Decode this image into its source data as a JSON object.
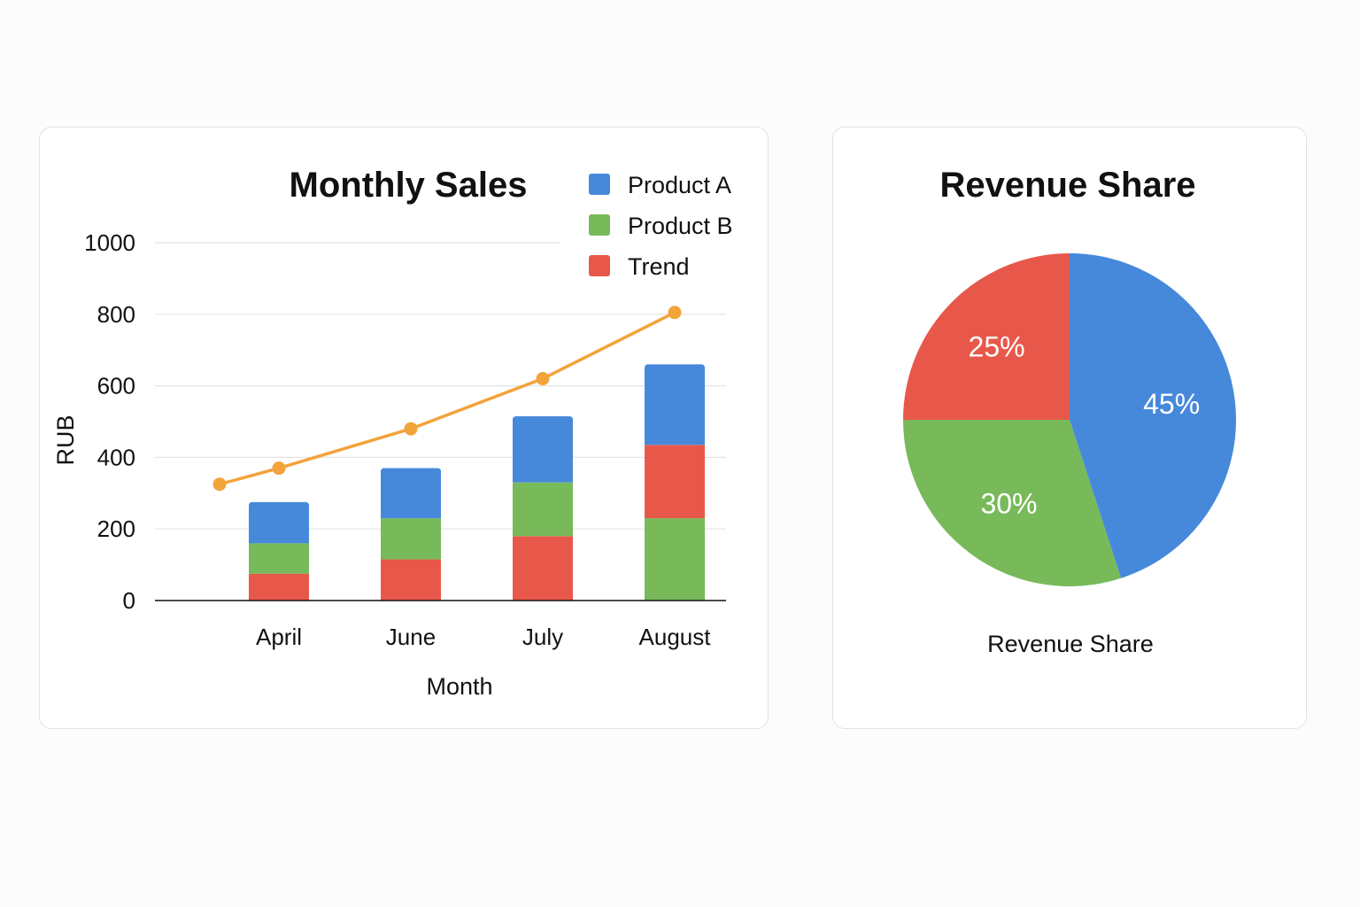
{
  "chart_data": [
    {
      "type": "bar",
      "stacked": true,
      "title": "Monthly Sales",
      "xlabel": "Month",
      "ylabel": "RUB",
      "ylim": [
        0,
        1000
      ],
      "yticks": [
        "0",
        "200",
        "400",
        "600",
        "800",
        "1000"
      ],
      "grid": true,
      "legend_position": "top-right",
      "categories": [
        "April",
        "June",
        "July",
        "August"
      ],
      "series": [
        {
          "name": "Trend",
          "color": "#e8584a",
          "values": [
            75,
            115,
            180,
            0
          ]
        },
        {
          "name": "Product B",
          "color": "#78b95a",
          "values": [
            85,
            115,
            150,
            230
          ]
        },
        {
          "name": "Product A",
          "color": "#4689db",
          "values": [
            115,
            140,
            185,
            0
          ]
        }
      ],
      "august_extra": {
        "color": "#e8584a",
        "value": 205
      },
      "august_top": {
        "color": "#4689db",
        "value": 225
      },
      "legend": [
        {
          "label": "Product A",
          "color": "#4689db"
        },
        {
          "label": "Product B",
          "color": "#78b95a"
        },
        {
          "label": "Trend",
          "color": "#e8584a"
        }
      ],
      "trend_line": {
        "color": "#f2a33a",
        "points": [
          {
            "x": "",
            "y": 325
          },
          {
            "x": "April",
            "y": 370
          },
          {
            "x": "June",
            "y": 480
          },
          {
            "x": "July",
            "y": 620
          },
          {
            "x": "August",
            "y": 805
          }
        ]
      }
    },
    {
      "type": "pie",
      "title": "Revenue Share",
      "caption": "Revenue Share",
      "slices": [
        {
          "label": "45%",
          "value": 45,
          "color": "#4689db"
        },
        {
          "label": "30%",
          "value": 30,
          "color": "#78b95a"
        },
        {
          "label": "25%",
          "value": 25,
          "color": "#e8584a"
        }
      ]
    }
  ]
}
